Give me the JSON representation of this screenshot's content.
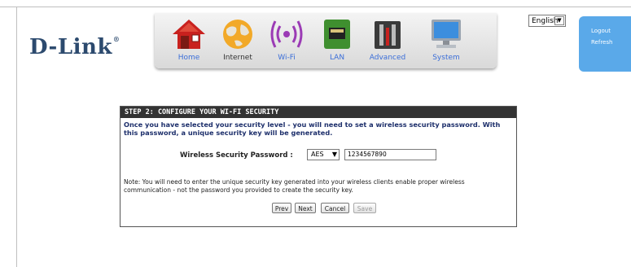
{
  "brand": {
    "logo_text": "D-Link",
    "logo_mark": "®"
  },
  "nav": {
    "items": [
      {
        "label": "Home",
        "icon": "home-icon"
      },
      {
        "label": "Internet",
        "icon": "globe-icon"
      },
      {
        "label": "Wi-Fi",
        "icon": "wifi-icon"
      },
      {
        "label": "LAN",
        "icon": "lan-icon"
      },
      {
        "label": "Advanced",
        "icon": "tools-icon"
      },
      {
        "label": "System",
        "icon": "computer-icon"
      }
    ]
  },
  "language": {
    "selected": "English"
  },
  "side_links": {
    "logout": "Logout",
    "refresh": "Refresh"
  },
  "wizard": {
    "title": "STEP 2: CONFIGURE YOUR WI-FI SECURITY",
    "intro": "Once you have selected your security level - you will need to set a wireless security password. With this password, a unique security key will be generated.",
    "password_label": "Wireless Security Password :",
    "encryption_selected": "AES",
    "password_value": "1234567890",
    "note": "Note: You will need to enter the unique security key generated into your wireless clients enable proper wireless communication - not the password you provided to create the security key.",
    "buttons": {
      "prev": "Prev",
      "next": "Next",
      "cancel": "Cancel",
      "save": "Save"
    }
  },
  "colors": {
    "brand": "#2c4a6e",
    "side_panel": "#5aa9e9",
    "wizard_header": "#333333",
    "intro_text": "#1d2f6b"
  }
}
